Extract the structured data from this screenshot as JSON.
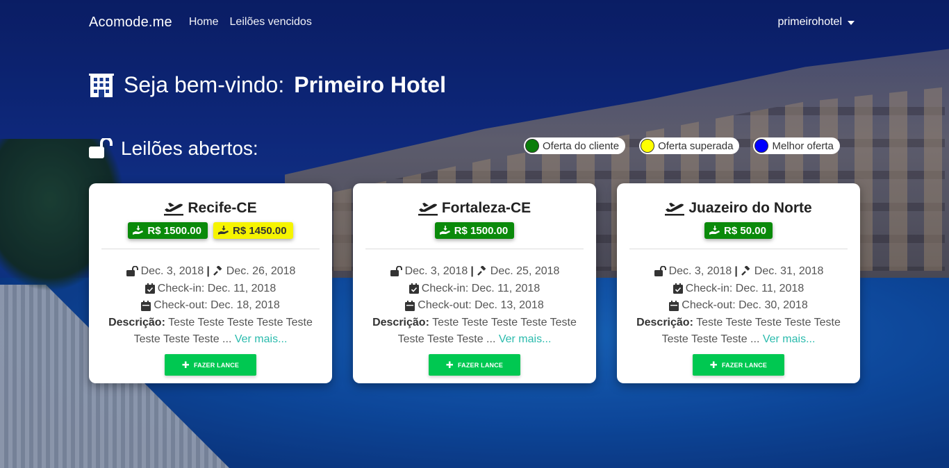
{
  "nav": {
    "brand": "Acomode.me",
    "links": [
      "Home",
      "Leilões vencidos"
    ],
    "user": "primeirohotel"
  },
  "welcome": {
    "prefix": "Seja bem-vindo:",
    "hotel_name": "Primeiro Hotel"
  },
  "open_auctions": {
    "title": "Leilões abertos:"
  },
  "legend": [
    {
      "label": "Oferta do cliente",
      "color": "#0a7d0a"
    },
    {
      "label": "Oferta superada",
      "color": "#ffff00"
    },
    {
      "label": "Melhor oferta",
      "color": "#0000ff"
    }
  ],
  "cards": [
    {
      "city": "Recife-CE",
      "bids": [
        {
          "value": "R$ 1500.00",
          "style": "green"
        },
        {
          "value": "R$ 1450.00",
          "style": "yellow"
        }
      ],
      "open_date": "Dec. 3, 2018",
      "close_date": "Dec. 26, 2018",
      "checkin": "Check-in: Dec. 11, 2018",
      "checkout": "Check-out: Dec. 18, 2018",
      "desc_label": "Descrição:",
      "desc_text": "Teste Teste Teste Teste Teste Teste Teste Teste ...",
      "more": "Ver mais...",
      "button": "FAZER LANCE"
    },
    {
      "city": "Fortaleza-CE",
      "bids": [
        {
          "value": "R$ 1500.00",
          "style": "green"
        }
      ],
      "open_date": "Dec. 3, 2018",
      "close_date": "Dec. 25, 2018",
      "checkin": "Check-in: Dec. 11, 2018",
      "checkout": "Check-out: Dec. 13, 2018",
      "desc_label": "Descrição:",
      "desc_text": "Teste Teste Teste Teste Teste Teste Teste Teste ...",
      "more": "Ver mais...",
      "button": "FAZER LANCE"
    },
    {
      "city": "Juazeiro do Norte",
      "bids": [
        {
          "value": "R$ 50.00",
          "style": "green"
        }
      ],
      "open_date": "Dec. 3, 2018",
      "close_date": "Dec. 31, 2018",
      "checkin": "Check-in: Dec. 11, 2018",
      "checkout": "Check-out: Dec. 30, 2018",
      "desc_label": "Descrição:",
      "desc_text": "Teste Teste Teste Teste Teste Teste Teste Teste ...",
      "more": "Ver mais...",
      "button": "FAZER LANCE"
    }
  ]
}
